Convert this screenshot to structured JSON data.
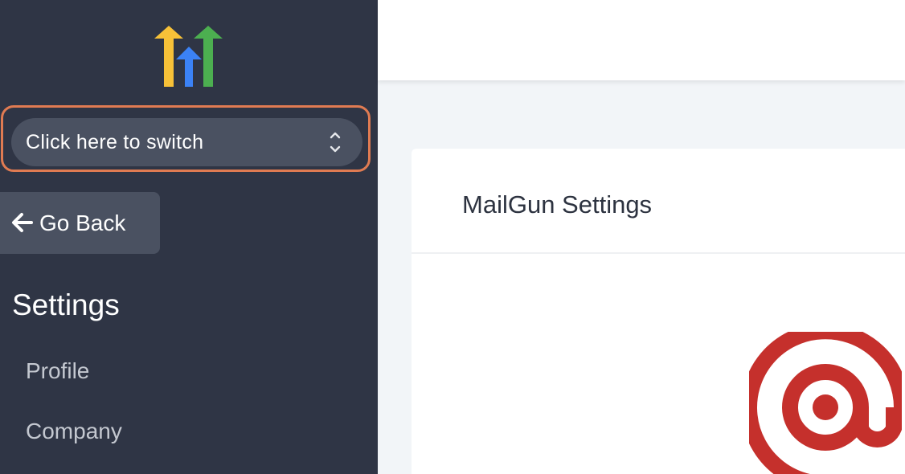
{
  "sidebar": {
    "logo_icon": "highlevel-arrows-logo",
    "logo_colors": [
      "#f7c138",
      "#3b82f6",
      "#4caf50"
    ],
    "switcher": {
      "label": "Click here to switch",
      "icon": "chevron-up-down-icon"
    },
    "go_back": {
      "label": "Go Back",
      "icon": "arrow-left-icon"
    },
    "section_title": "Settings",
    "nav_items": [
      {
        "label": "Profile"
      },
      {
        "label": "Company"
      }
    ]
  },
  "main": {
    "card_title": "MailGun Settings",
    "provider_logo": "mailgun-at-logo",
    "provider_color": "#c5302c"
  },
  "colors": {
    "sidebar_bg": "#2f3545",
    "highlight_outline": "#e07b52",
    "control_bg": "#4a5161",
    "content_bg": "#f2f5f8"
  }
}
